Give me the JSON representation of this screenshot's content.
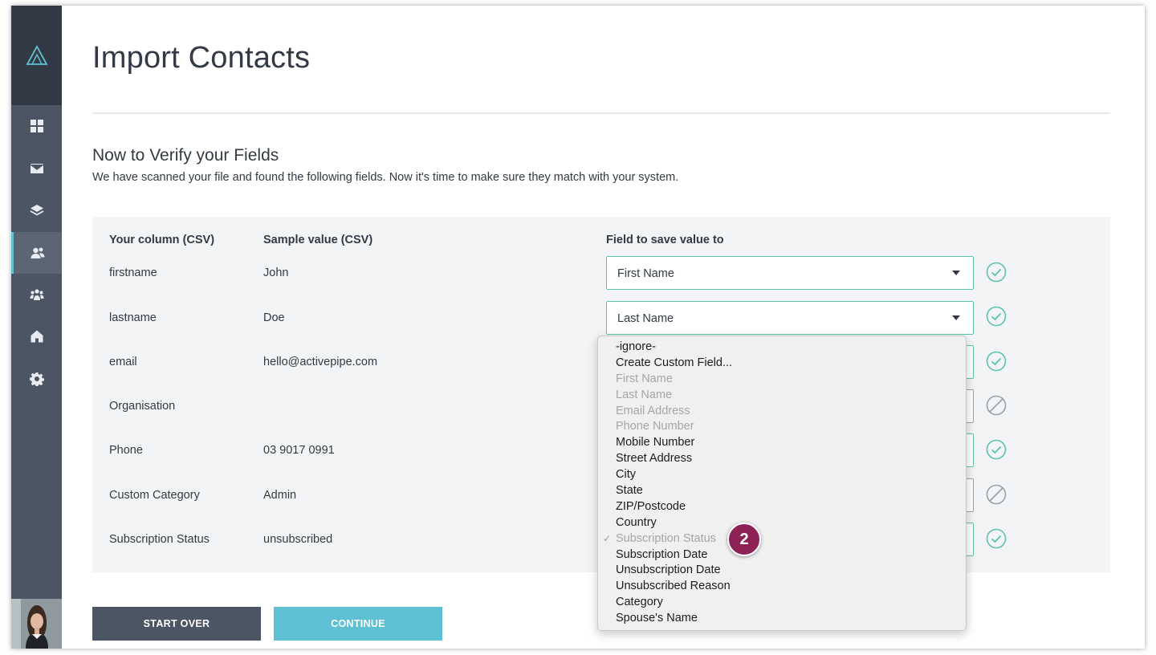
{
  "page": {
    "title": "Import Contacts",
    "section_title": "Now to Verify your Fields",
    "section_desc": "We have scanned your file and found the following fields. Now it's time to make sure they match with your system."
  },
  "sidebar": {
    "items": [
      {
        "icon": "dashboard-icon"
      },
      {
        "icon": "mail-icon"
      },
      {
        "icon": "layers-icon"
      },
      {
        "icon": "contacts-icon",
        "active": true
      },
      {
        "icon": "team-icon"
      },
      {
        "icon": "home-icon"
      },
      {
        "icon": "gear-icon"
      }
    ]
  },
  "table": {
    "headers": [
      "Your column (CSV)",
      "Sample value (CSV)",
      "Field to save value to"
    ],
    "rows": [
      {
        "column": "firstname",
        "sample": "John",
        "field": "First Name",
        "status": "ok"
      },
      {
        "column": "lastname",
        "sample": "Doe",
        "field": "Last Name",
        "status": "ok"
      },
      {
        "column": "email",
        "sample": "hello@activepipe.com",
        "field": "",
        "status": "ok"
      },
      {
        "column": "Organisation",
        "sample": "",
        "field": "",
        "status": "ignored"
      },
      {
        "column": "Phone",
        "sample": "03 9017 0991",
        "field": "",
        "status": "ok"
      },
      {
        "column": "Custom Category",
        "sample": "Admin",
        "field": "",
        "status": "ignored"
      },
      {
        "column": "Subscription Status",
        "sample": "unsubscribed",
        "field": "",
        "status": "ok"
      }
    ]
  },
  "dropdown": {
    "options": [
      {
        "label": "-ignore-",
        "disabled": false
      },
      {
        "label": "Create Custom Field...",
        "disabled": false
      },
      {
        "label": "First Name",
        "disabled": true
      },
      {
        "label": "Last Name",
        "disabled": true
      },
      {
        "label": "Email Address",
        "disabled": true
      },
      {
        "label": "Phone Number",
        "disabled": true
      },
      {
        "label": "Mobile Number",
        "disabled": false
      },
      {
        "label": "Street Address",
        "disabled": false
      },
      {
        "label": "City",
        "disabled": false
      },
      {
        "label": "State",
        "disabled": false
      },
      {
        "label": "ZIP/Postcode",
        "disabled": false
      },
      {
        "label": "Country",
        "disabled": false
      },
      {
        "label": "Subscription Status",
        "disabled": true,
        "checked": true
      },
      {
        "label": "Subscription Date",
        "disabled": false
      },
      {
        "label": "Unsubscription Date",
        "disabled": false
      },
      {
        "label": "Unsubscribed Reason",
        "disabled": false
      },
      {
        "label": "Category",
        "disabled": false
      },
      {
        "label": "Spouse's Name",
        "disabled": false
      }
    ],
    "check_glyph": "✓"
  },
  "badge": {
    "label": "2"
  },
  "buttons": {
    "start_over": "START OVER",
    "continue": "CONTINUE"
  },
  "colors": {
    "ok": "#5fc3a9",
    "ignored": "#9aa0a8",
    "sidebar": "#4b5563",
    "accent": "#5fc3d2",
    "badge": "#8e2256"
  }
}
